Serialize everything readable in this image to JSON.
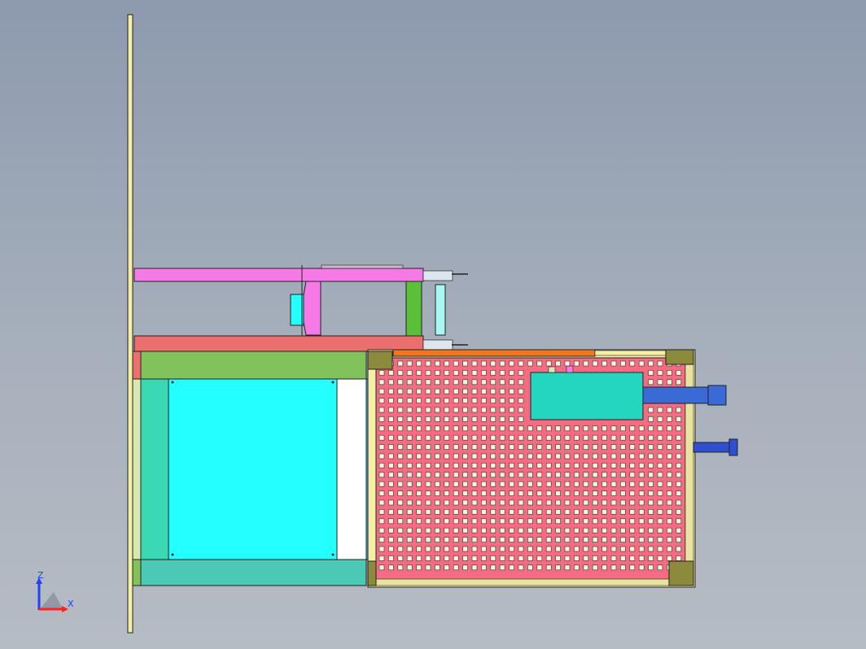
{
  "viewport": {
    "background_top": "#8d9aae",
    "background_bottom": "#b6bcc4"
  },
  "model": {
    "colors": {
      "post": "#f3efa6",
      "pink_beam": "#f57ae6",
      "red_beam": "#ec6f6f",
      "green_column": "#5bbf3a",
      "green_panel": "#82c25a",
      "cyan_panel": "#24ffff",
      "teal_panel": "#3ad9b4",
      "teal_bottom": "#4cc8b6",
      "white_panel": "#ffffff",
      "blue_strip": "#3fc3f5",
      "mesh_fill": "#f46b82",
      "mesh_hole": "#f6f4dc",
      "frame_corner": "#8c8a3c",
      "orange_bar": "#f1771f",
      "motor_box": "#24d6c0",
      "motor_shaft": "#3a6ad6",
      "cylinder": "#2f4fd0",
      "roller": "#a9f7f2"
    },
    "parts": [
      "vertical-post",
      "upper-frame",
      "lower-cabinet",
      "perforated-mesh-table",
      "drive-motor",
      "air-cylinder"
    ]
  },
  "axis_triad": {
    "z_label": "Z",
    "x_label": "X",
    "z_color": "#1e40ff",
    "x_color": "#ff2020"
  }
}
